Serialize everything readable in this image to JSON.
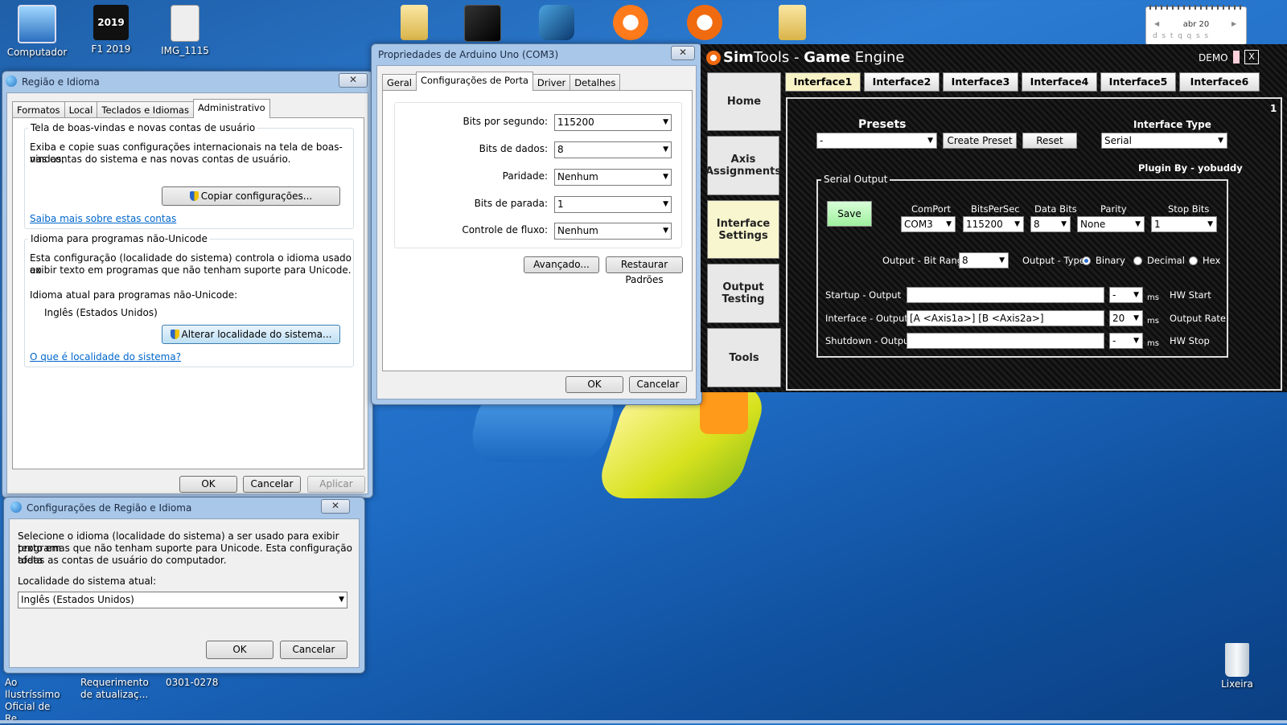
{
  "desktop": {
    "icons": [
      {
        "label": "Computador",
        "icon": "computer-icon"
      },
      {
        "label": "F1 2019",
        "icon": "game-shortcut-icon",
        "badge": "2019"
      },
      {
        "label": "IMG_1115",
        "icon": "image-file-icon"
      },
      {
        "label": "",
        "icon": "folder-zip-icon"
      },
      {
        "label": "",
        "icon": "app-shortcut-icon"
      },
      {
        "label": "",
        "icon": "app-shortcut-icon"
      },
      {
        "label": "",
        "icon": "shifter-app-icon"
      },
      {
        "label": "",
        "icon": "simtools-shortcut-icon"
      },
      {
        "label": "",
        "icon": "folder-zip-icon"
      }
    ],
    "bottom_icons": [
      {
        "label": "Ao Ilustríssimo Oficial de Re..."
      },
      {
        "label": "Requerimento de atualizaç..."
      },
      {
        "label": "0301-0278"
      }
    ],
    "recycle_label": "Lixeira",
    "calendar": {
      "month": "abr 20",
      "days": "d  s  t  q  q  s  s"
    }
  },
  "region_window": {
    "title": "Região e Idioma",
    "tabs": [
      "Formatos",
      "Local",
      "Teclados e Idiomas",
      "Administrativo"
    ],
    "group1": {
      "label": "Tela de boas-vindas e novas contas de usuário",
      "text1": "Exiba e copie suas configurações internacionais na tela de boas-vindas,",
      "text2": "nas contas do sistema e nas novas contas de usuário.",
      "button": "Copiar configurações...",
      "link": "Saiba mais sobre estas contas"
    },
    "group2": {
      "label": "Idioma para programas não-Unicode",
      "text1": "Esta configuração (localidade do sistema) controla o idioma usado ao",
      "text2": "exibir texto em programas que não tenham suporte para Unicode.",
      "current_label": "Idioma atual para programas não-Unicode:",
      "current_value": "Inglês (Estados Unidos)",
      "button": "Alterar localidade do sistema...",
      "link": "O que é localidade do sistema?"
    },
    "ok": "OK",
    "cancel": "Cancelar",
    "apply": "Aplicar"
  },
  "locale_dialog": {
    "title": "Configurações de Região e Idioma",
    "text1": "Selecione o idioma (localidade do sistema) a ser usado para exibir texto em",
    "text2": "programas que não tenham suporte para Unicode. Esta configuração afeta",
    "text3": "todas as contas de usuário do computador.",
    "current_label": "Localidade do sistema atual:",
    "current_value": "Inglês (Estados Unidos)",
    "ok": "OK",
    "cancel": "Cancelar"
  },
  "arduino_window": {
    "title": "Propriedades de Arduino Uno (COM3)",
    "tabs": [
      "Geral",
      "Configurações de Porta",
      "Driver",
      "Detalhes"
    ],
    "fields": [
      {
        "label": "Bits por segundo:",
        "value": "115200"
      },
      {
        "label": "Bits de dados:",
        "value": "8"
      },
      {
        "label": "Paridade:",
        "value": "Nenhum"
      },
      {
        "label": "Bits de parada:",
        "value": "1"
      },
      {
        "label": "Controle de fluxo:",
        "value": "Nenhum"
      }
    ],
    "advanced": "Avançado...",
    "restore": "Restaurar Padrões",
    "ok": "OK",
    "cancel": "Cancelar"
  },
  "simtools": {
    "title_sim": "Sim",
    "title_tools": "Tools",
    "title_rest": " - ",
    "title_game": "Game",
    "title_engine": " Engine",
    "demo": "DEMO",
    "close": "X",
    "side": [
      "Home",
      "Axis Assignments",
      "Interface Settings",
      "Output Testing",
      "Tools"
    ],
    "interface_tabs": [
      "Interface1",
      "Interface2",
      "Interface3",
      "Interface4",
      "Interface5",
      "Interface6"
    ],
    "page_number": "1",
    "presets_label": "Presets",
    "presets_value": "-",
    "create_preset": "Create Preset",
    "reset": "Reset",
    "interface_type_label": "Interface Type",
    "interface_type_value": "Serial",
    "plugin_by": "Plugin By - yobuddy",
    "serial_output_label": "Serial Output",
    "save": "Save",
    "comport_label": "ComPort",
    "comport_value": "COM3",
    "bps_label": "BitsPerSec",
    "bps_value": "115200",
    "databits_label": "Data Bits",
    "databits_value": "8",
    "parity_label": "Parity",
    "parity_value": "None",
    "stopbits_label": "Stop Bits",
    "stopbits_value": "1",
    "bitrange_label": "Output - Bit Range",
    "bitrange_value": "8",
    "outtype_label": "Output - Type",
    "binary": "Binary",
    "decimal": "Decimal",
    "hex": "Hex",
    "startup_label": "Startup - Output",
    "startup_value": "",
    "startup_ms": "-",
    "interface_label": "Interface - Output",
    "interface_value": "[A <Axis1a>] [B <Axis2a>]",
    "interface_ms": "20",
    "shutdown_label": "Shutdown - Output",
    "shutdown_value": "",
    "shutdown_ms": "-",
    "ms": "ms",
    "hw_start": "HW Start",
    "output_rate": "Output Rate",
    "hw_stop": "HW Stop"
  }
}
